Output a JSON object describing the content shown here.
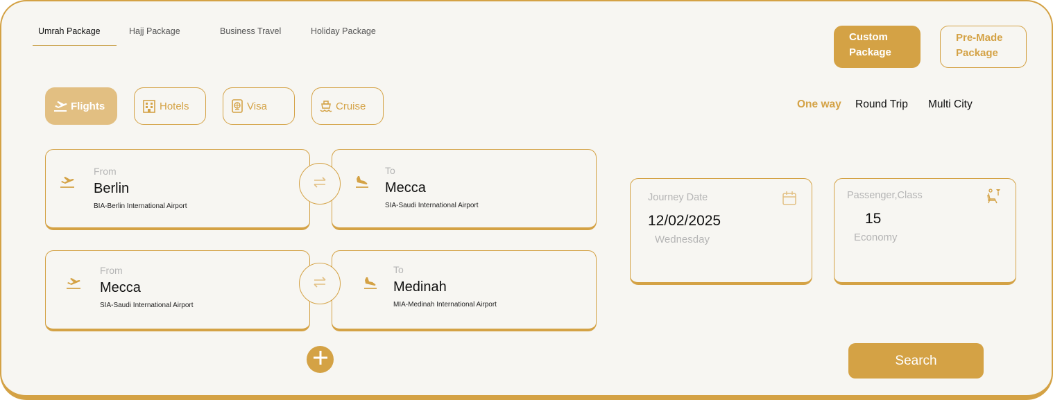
{
  "package_tabs": [
    {
      "label": "Umrah Package",
      "active": true
    },
    {
      "label": "Hajj Package",
      "active": false
    },
    {
      "label": "Business Travel",
      "active": false
    },
    {
      "label": "Holiday Package",
      "active": false
    }
  ],
  "package_buttons": {
    "custom": "Custom Package",
    "premade": "Pre-Made Package"
  },
  "categories": [
    {
      "label": "Flights",
      "icon": "plane-takeoff-icon",
      "active": true
    },
    {
      "label": "Hotels",
      "icon": "hotel-icon",
      "active": false
    },
    {
      "label": "Visa",
      "icon": "passport-icon",
      "active": false
    },
    {
      "label": "Cruise",
      "icon": "ship-icon",
      "active": false
    }
  ],
  "trip_types": [
    {
      "label": "One way",
      "active": true
    },
    {
      "label": "Round Trip",
      "active": false
    },
    {
      "label": "Multi City",
      "active": false
    }
  ],
  "routes": [
    {
      "from": {
        "label": "From",
        "city": "Berlin",
        "airport": "BIA-Berlin International Airport"
      },
      "to": {
        "label": "To",
        "city": "Mecca",
        "airport": "SIA-Saudi International Airport"
      }
    },
    {
      "from": {
        "label": "From",
        "city": "Mecca",
        "airport": "SIA-Saudi International Airport"
      },
      "to": {
        "label": "To",
        "city": "Medinah",
        "airport": "MIA-Medinah International Airport"
      }
    }
  ],
  "journey": {
    "label": "Journey Date",
    "date": "12/02/2025",
    "weekday": "Wednesday"
  },
  "passenger": {
    "label": "Passenger,Class",
    "count": "15",
    "class": "Economy"
  },
  "search_label": "Search",
  "colors": {
    "accent": "#d4a245",
    "accent_light": "#e2bf82",
    "background": "#f7f6f2",
    "muted": "#b5b5b5"
  }
}
